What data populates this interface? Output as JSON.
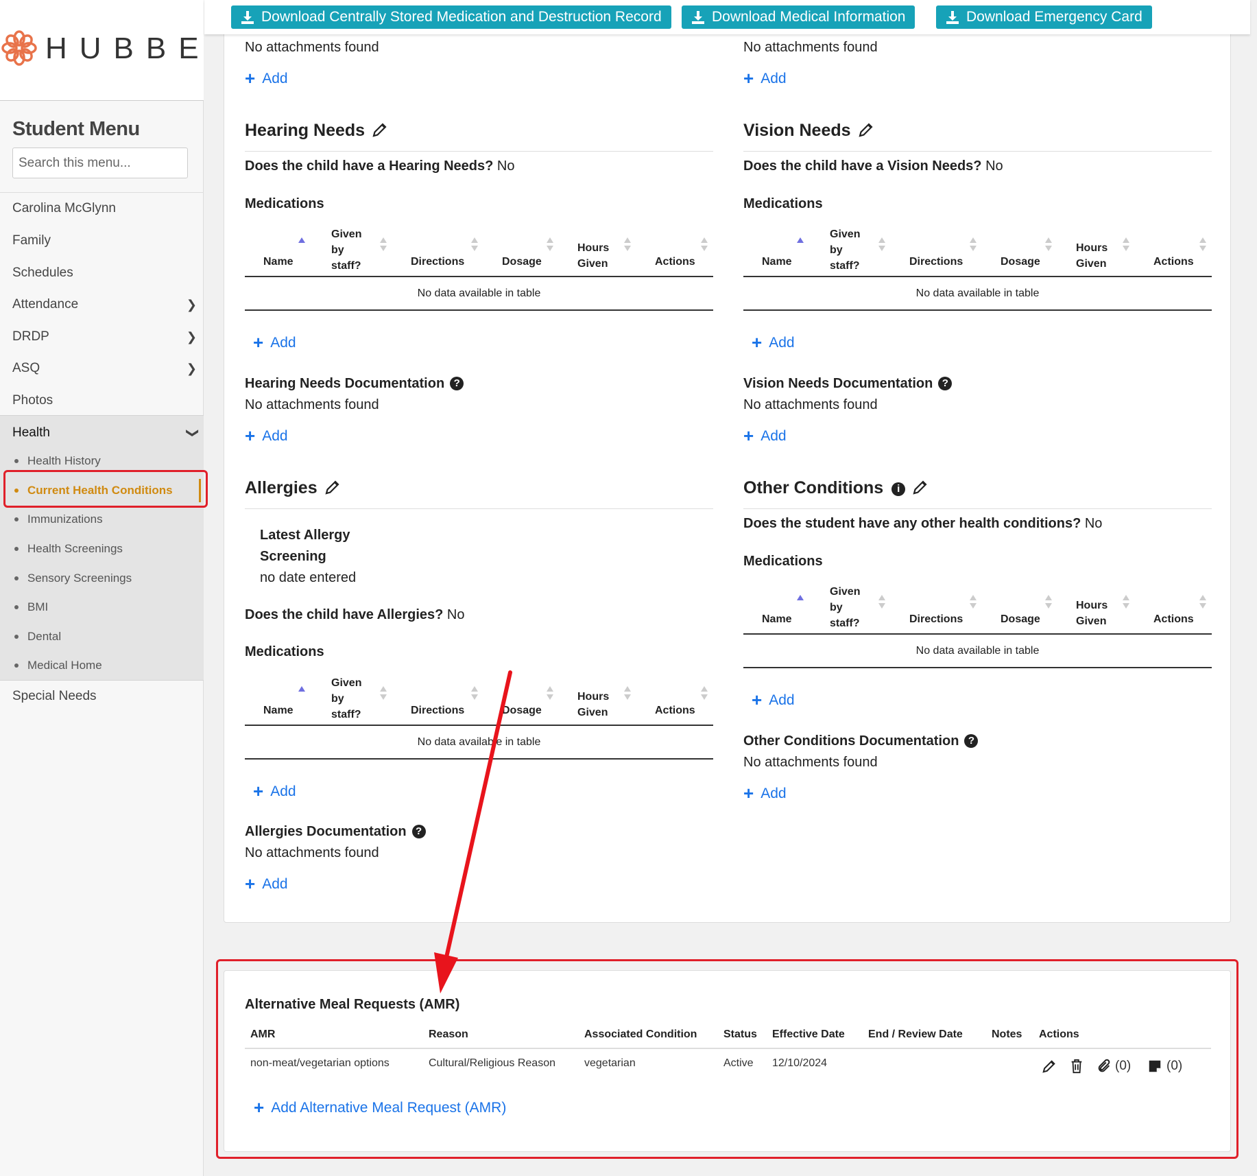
{
  "brand": "HUBBE",
  "sidebar": {
    "title": "Student Menu",
    "search_placeholder": "Search this menu...",
    "student_name": "Carolina McGlynn",
    "items": [
      "Family",
      "Schedules",
      "Attendance",
      "DRDP",
      "ASQ",
      "Photos"
    ],
    "health": "Health",
    "health_sub": [
      "Health History",
      "Current Health Conditions",
      "Immunizations",
      "Health Screenings",
      "Sensory Screenings",
      "BMI",
      "Dental",
      "Medical Home"
    ],
    "special_needs": "Special Needs"
  },
  "topbar": {
    "btn1": "Download Centrally Stored Medication and Destruction Record",
    "btn2": "Download Medical Information",
    "btn3": "Download Emergency Card",
    "color": "#17a2b8"
  },
  "common": {
    "no_attachments": "No attachments found",
    "add": "Add",
    "medications": "Medications",
    "no_data": "No data available in table",
    "cols": {
      "name": "Name",
      "given": [
        "Given",
        "by",
        "staff?"
      ],
      "directions": "Directions",
      "dosage": "Dosage",
      "hours": [
        "Hours",
        "Given"
      ],
      "actions": "Actions"
    }
  },
  "hearing": {
    "title": "Hearing Needs",
    "question": "Does the child have a Hearing Needs?",
    "answer": "No",
    "doc_title": "Hearing Needs Documentation"
  },
  "vision": {
    "title": "Vision Needs",
    "question": "Does the child have a Vision Needs?",
    "answer": "No",
    "doc_title": "Vision Needs Documentation"
  },
  "allergies": {
    "title": "Allergies",
    "latest_label_1": "Latest Allergy",
    "latest_label_2": "Screening",
    "latest_value": "no date entered",
    "question": "Does the child have Allergies?",
    "answer": "No",
    "doc_title": "Allergies Documentation"
  },
  "other": {
    "title": "Other Conditions",
    "question": "Does the student have any other health conditions?",
    "answer": "No",
    "doc_title": "Other Conditions Documentation"
  },
  "amr": {
    "title": "Alternative Meal Requests (AMR)",
    "headers": [
      "AMR",
      "Reason",
      "Associated Condition",
      "Status",
      "Effective Date",
      "End / Review Date",
      "Notes",
      "Actions"
    ],
    "row": {
      "amr": "non-meat/vegetarian options",
      "reason": "Cultural/Religious Reason",
      "condition": "vegetarian",
      "status": "Active",
      "effective": "12/10/2024",
      "end": "",
      "notes": "",
      "attach_count": "(0)",
      "note_count": "(0)"
    },
    "add_label": "Add Alternative Meal Request (AMR)"
  },
  "colors": {
    "accent": "#d08a10",
    "link": "#1a73e8",
    "highlight": "#e0202a"
  }
}
